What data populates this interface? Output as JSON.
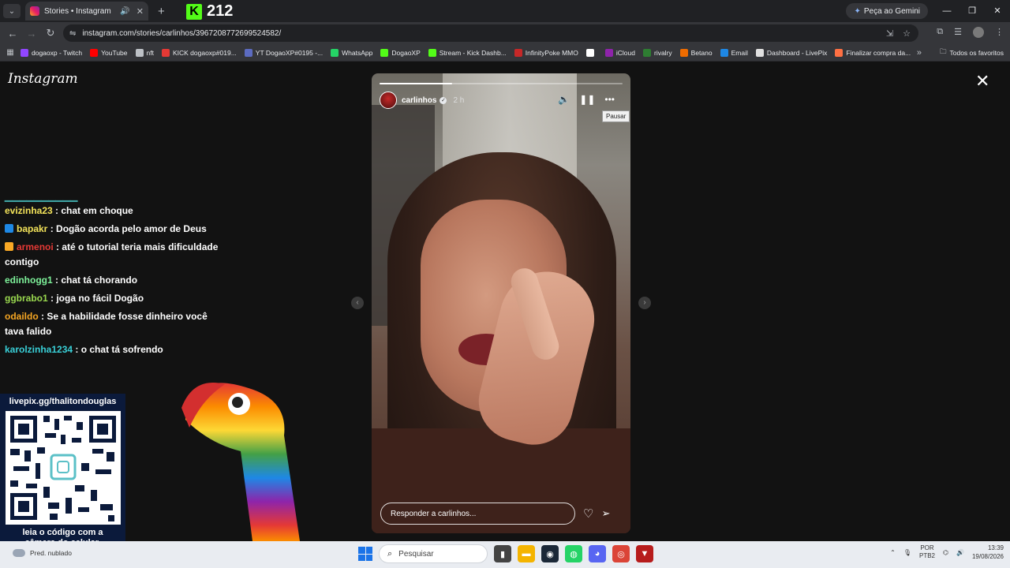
{
  "browser": {
    "tab_title": "Stories • Instagram",
    "kick_count": "212",
    "gemini_label": "Peça ao Gemini",
    "url": "instagram.com/stories/carlinhos/3967208772699524582/",
    "bookmarks": [
      {
        "label": "dogaoxp - Twitch",
        "color": "#9146ff"
      },
      {
        "label": "YouTube",
        "color": "#ff0000"
      },
      {
        "label": "nft",
        "color": "#bdc1c6"
      },
      {
        "label": "KICK dogaoxp#019...",
        "color": "#e53935"
      },
      {
        "label": "YT DogaoXP#0195 -...",
        "color": "#5c6bc0"
      },
      {
        "label": "WhatsApp",
        "color": "#25d366"
      },
      {
        "label": "DogaoXP",
        "color": "#53fc18"
      },
      {
        "label": "Stream - Kick Dashb...",
        "color": "#53fc18"
      },
      {
        "label": "InfinityPoke MMO",
        "color": "#c62828"
      },
      {
        "label": "",
        "color": "#ffffff"
      },
      {
        "label": "iCloud",
        "color": "#8e24aa"
      },
      {
        "label": "rivalry",
        "color": "#2e7d32"
      },
      {
        "label": "Betano",
        "color": "#ef6c00"
      },
      {
        "label": "Email",
        "color": "#1e88e5"
      },
      {
        "label": "Dashboard - LivePix",
        "color": "#e0e0e0"
      },
      {
        "label": "Finalizar compra da...",
        "color": "#ff7043"
      }
    ],
    "all_bookmarks": "Todos os favoritos"
  },
  "instagram": {
    "logo": "Instagram",
    "story": {
      "username": "carlinhos",
      "time": "2 h",
      "progress": 0.3,
      "tooltip": "Pausar",
      "reply_placeholder": "Responder a carlinhos..."
    }
  },
  "chat": {
    "messages": [
      {
        "user": "evizinha23",
        "text": ": chat em choque",
        "color": "#f3e35a",
        "badge": ""
      },
      {
        "user": "bapakr",
        "text": ": Dogão acorda pelo amor de Deus",
        "color": "#f3e35a",
        "badge": "#1e88e5"
      },
      {
        "user": "armenoi",
        "text": ": até o tutorial teria mais dificuldade contigo",
        "color": "#e53935",
        "badge": "#f9a825"
      },
      {
        "user": "edinhogg1",
        "text": ": chat tá chorando",
        "color": "#7ef29a",
        "badge": ""
      },
      {
        "user": "ggbrabo1",
        "text": ": joga no fácil Dogão",
        "color": "#9ad94f",
        "badge": ""
      },
      {
        "user": "odaildo",
        "text": ": Se a habilidade fosse dinheiro você tava falido",
        "color": "#f5a623",
        "badge": ""
      },
      {
        "user": "karolzinha1234",
        "text": ": o chat tá sofrendo",
        "color": "#39d0d8",
        "badge": ""
      }
    ]
  },
  "livepix": {
    "url": "livepix.gg/thalitondouglas",
    "caption_line1": "leia o código com a",
    "caption_line2": "câmera do celular."
  },
  "taskbar": {
    "weather": "Pred. nublado",
    "search_placeholder": "Pesquisar",
    "lang1": "POR",
    "lang2": "PTB2",
    "time": "13:39",
    "date": "19/08/2026"
  }
}
